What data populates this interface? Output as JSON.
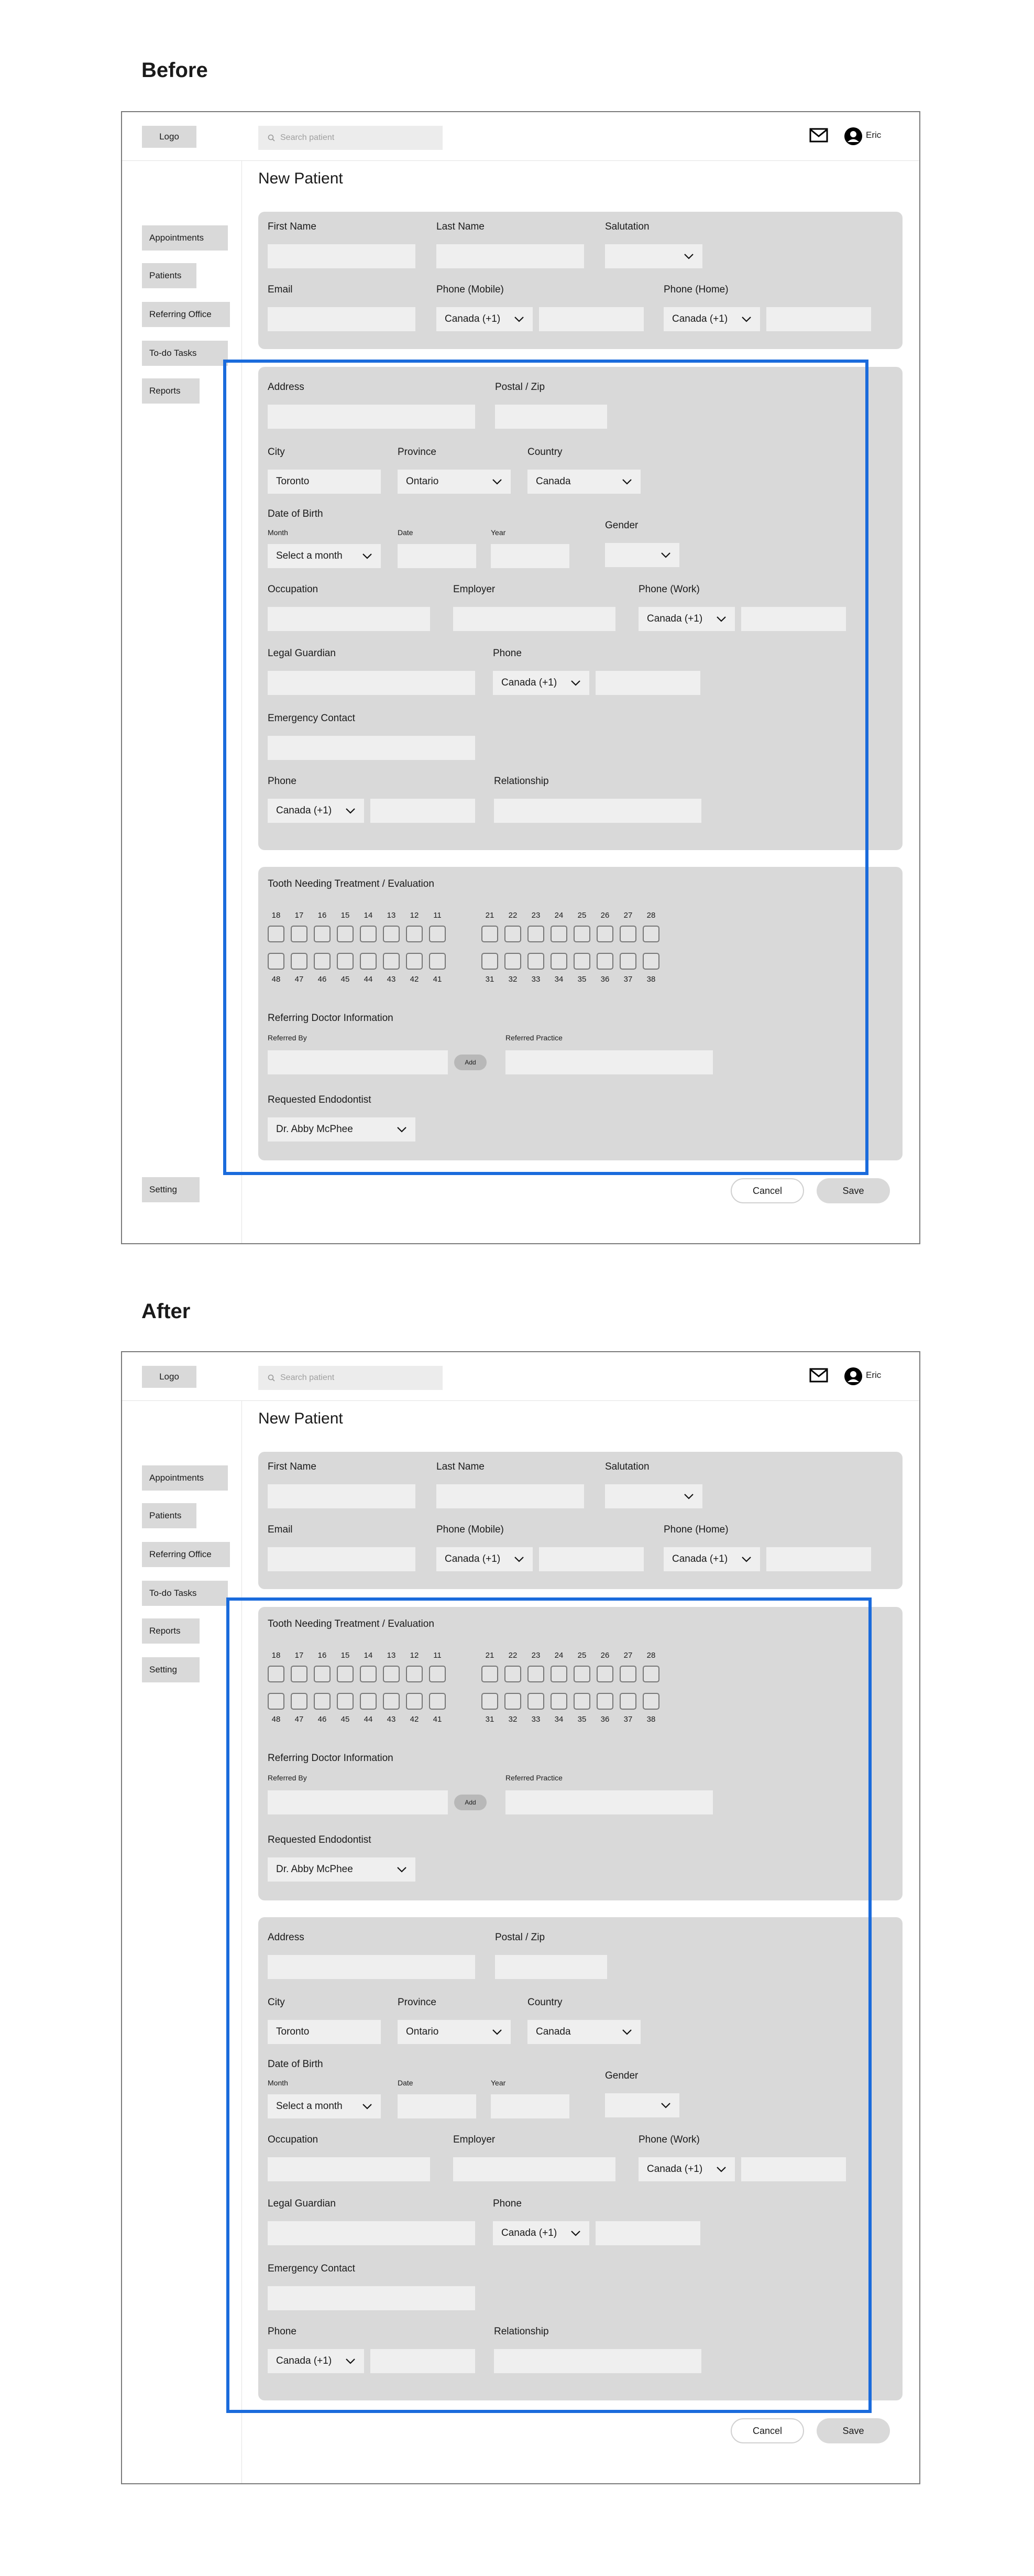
{
  "sections": {
    "before": "Before",
    "after": "After"
  },
  "header": {
    "logo": "Logo",
    "search_placeholder": "Search patient",
    "user_name": "Eric"
  },
  "page_title": "New Patient",
  "nav": {
    "items": [
      "Appointments",
      "Patients",
      "Referring Office",
      "To-do Tasks",
      "Reports"
    ],
    "setting": "Setting"
  },
  "contact": {
    "first_name": "First Name",
    "last_name": "Last Name",
    "salutation": "Salutation",
    "email": "Email",
    "phone_mobile": "Phone (Mobile)",
    "phone_home": "Phone (Home)",
    "country_code": "Canada (+1)"
  },
  "address": {
    "address": "Address",
    "postal": "Postal / Zip",
    "city": "City",
    "city_value": "Toronto",
    "province": "Province",
    "province_value": "Ontario",
    "country": "Country",
    "country_value": "Canada",
    "dob": "Date of Birth",
    "month": "Month",
    "month_value": "Select a month",
    "date": "Date",
    "year": "Year",
    "gender": "Gender",
    "occupation": "Occupation",
    "employer": "Employer",
    "phone_work": "Phone (Work)",
    "guardian": "Legal Guardian",
    "phone": "Phone",
    "emergency": "Emergency Contact",
    "relationship": "Relationship",
    "country_code": "Canada (+1)"
  },
  "treatment": {
    "title": "Tooth Needing Treatment / Evaluation",
    "upper_left": [
      "18",
      "17",
      "16",
      "15",
      "14",
      "13",
      "12",
      "11"
    ],
    "upper_right": [
      "21",
      "22",
      "23",
      "24",
      "25",
      "26",
      "27",
      "28"
    ],
    "lower_left": [
      "48",
      "47",
      "46",
      "45",
      "44",
      "43",
      "42",
      "41"
    ],
    "lower_right": [
      "31",
      "32",
      "33",
      "34",
      "35",
      "36",
      "37",
      "38"
    ],
    "referring_title": "Referring Doctor Information",
    "referred_by": "Referred By",
    "add": "Add",
    "referred_practice": "Referred Practice",
    "endodontist_title": "Requested Endodontist",
    "endodontist_value": "Dr. Abby McPhee"
  },
  "actions": {
    "cancel": "Cancel",
    "save": "Save"
  },
  "colors": {
    "highlight": "#1a6bdc",
    "panel": "#d9d9d9",
    "field": "#efefef"
  }
}
